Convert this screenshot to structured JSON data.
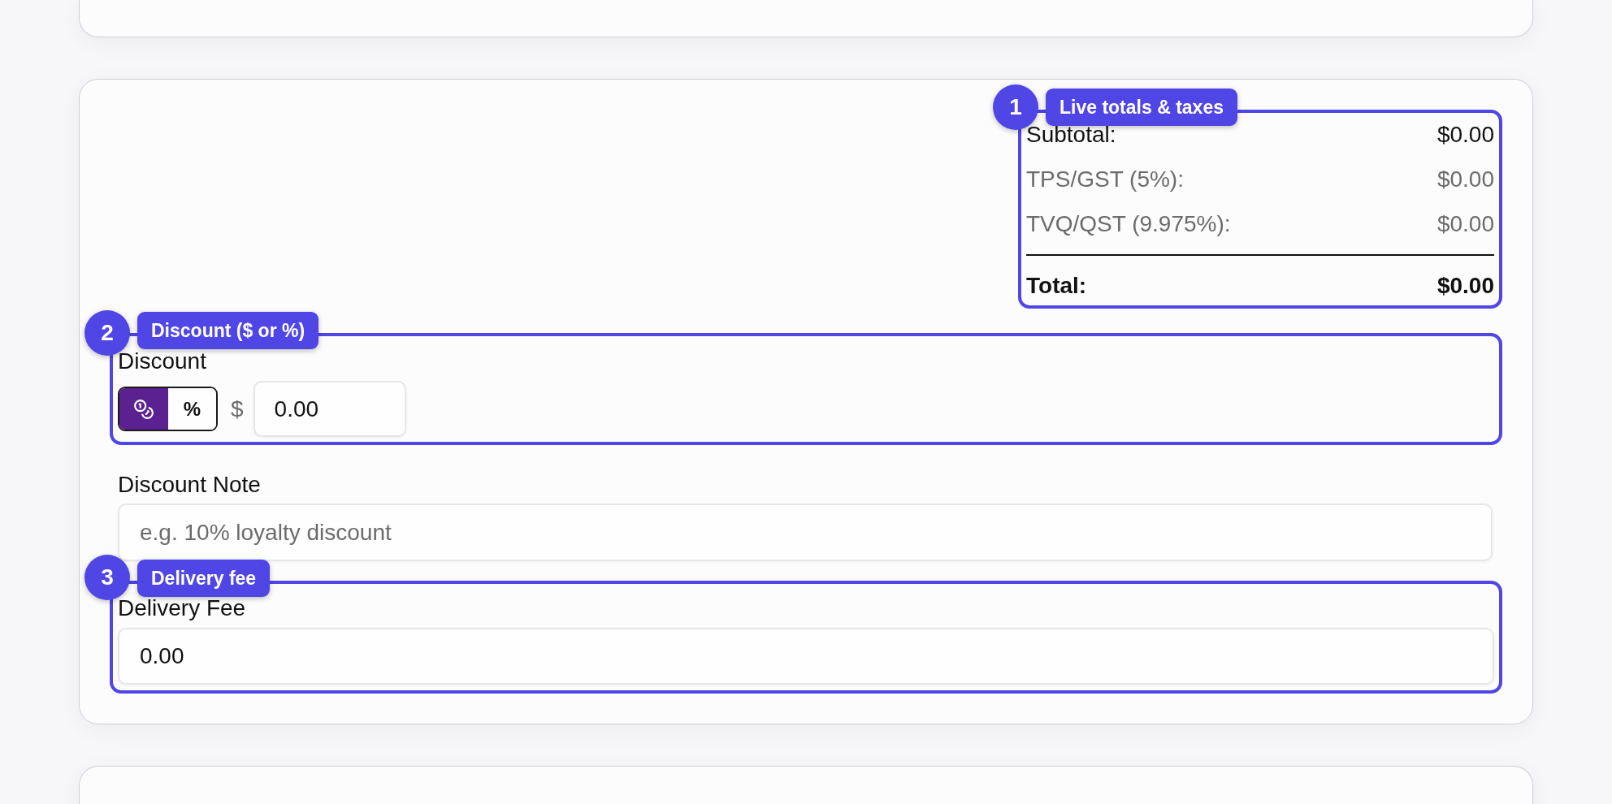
{
  "totals": {
    "callout": {
      "number": "1",
      "label": "Live totals & taxes"
    },
    "rows": [
      {
        "kind": "subtotal",
        "label": "Subtotal:",
        "value": "$0.00"
      },
      {
        "kind": "tax",
        "label": "TPS/GST (5%):",
        "value": "$0.00"
      },
      {
        "kind": "tax",
        "label": "TVQ/QST (9.975%):",
        "value": "$0.00"
      },
      {
        "kind": "total",
        "label": "Total:",
        "value": "$0.00"
      }
    ]
  },
  "discount": {
    "callout": {
      "number": "2",
      "label": "Discount ($ or %)"
    },
    "label": "Discount",
    "modes": [
      {
        "kind": "icon",
        "selected": true
      },
      {
        "kind": "text",
        "label": "%",
        "selected": false
      }
    ],
    "prefix": "$",
    "value": "0.00"
  },
  "discount_note": {
    "label": "Discount Note",
    "placeholder": "e.g. 10% loyalty discount"
  },
  "delivery_fee": {
    "callout": {
      "number": "3",
      "label": "Delivery fee"
    },
    "label": "Delivery Fee",
    "value": "0.00"
  }
}
